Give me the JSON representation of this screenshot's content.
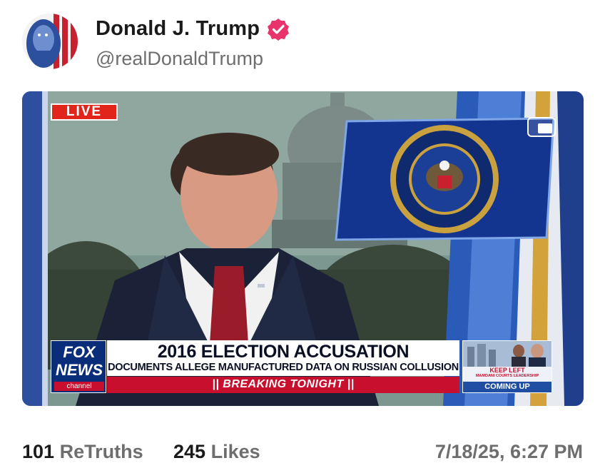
{
  "post": {
    "display_name": "Donald J. Trump",
    "handle": "@realDonaldTrump",
    "verified": true
  },
  "video": {
    "live_badge": "LIVE",
    "network_logo_top": "FOX",
    "network_logo_bottom": "NEWS",
    "network_logo_channel": "channel",
    "headline": "2016 ELECTION ACCUSATION",
    "subheadline": "DOCUMENTS ALLEGE MANUFACTURED DATA ON RUSSIAN COLLUSION",
    "breaking": "|| BREAKING TONIGHT ||",
    "coming_up_title": "KEEP LEFT",
    "coming_up_sub": "MAMDANI COURTS LEADERSHIP",
    "coming_up_label": "COMING UP"
  },
  "stats": {
    "retruths_count": "101",
    "retruths_label": "ReTruths",
    "likes_count": "245",
    "likes_label": "Likes",
    "timestamp": "7/18/25, 6:27 PM"
  },
  "colors": {
    "verified_badge": "#e8336b",
    "live_red": "#e1251b",
    "fox_blue": "#0a2d7a",
    "breaking_red": "#c8102e"
  }
}
